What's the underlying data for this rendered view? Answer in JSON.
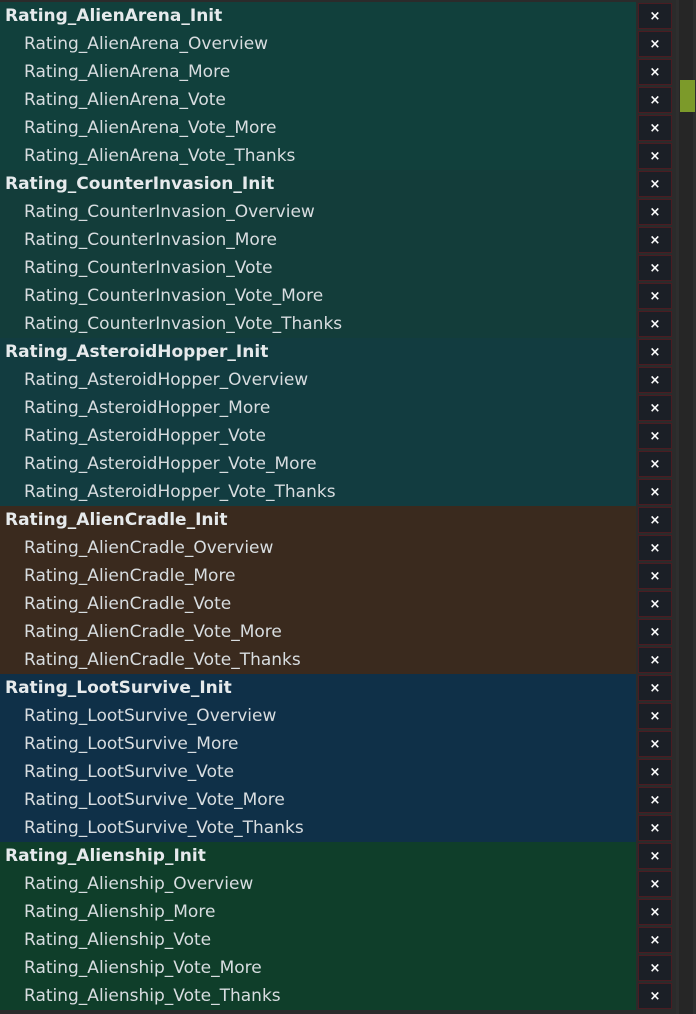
{
  "delete_glyph": "×",
  "groups": [
    {
      "color": "#11403c",
      "sep": "#22403f",
      "head": "Rating_AlienArena_Init",
      "items": [
        "Rating_AlienArena_Overview",
        "Rating_AlienArena_More",
        "Rating_AlienArena_Vote",
        "Rating_AlienArena_Vote_More",
        "Rating_AlienArena_Vote_Thanks"
      ]
    },
    {
      "color": "#133d3a",
      "sep": "#22403f",
      "head": "Rating_CounterInvasion_Init",
      "items": [
        "Rating_CounterInvasion_Overview",
        "Rating_CounterInvasion_More",
        "Rating_CounterInvasion_Vote",
        "Rating_CounterInvasion_Vote_More",
        "Rating_CounterInvasion_Vote_Thanks"
      ]
    },
    {
      "color": "#123c40",
      "sep": "#22403f",
      "head": "Rating_AsteroidHopper_Init",
      "items": [
        "Rating_AsteroidHopper_Overview",
        "Rating_AsteroidHopper_More",
        "Rating_AsteroidHopper_Vote",
        "Rating_AsteroidHopper_Vote_More",
        "Rating_AsteroidHopper_Vote_Thanks"
      ]
    },
    {
      "color": "#3a2a1e",
      "sep": "#4a3526",
      "head": "Rating_AlienCradle_Init",
      "items": [
        "Rating_AlienCradle_Overview",
        "Rating_AlienCradle_More",
        "Rating_AlienCradle_Vote",
        "Rating_AlienCradle_Vote_More",
        "Rating_AlienCradle_Vote_Thanks"
      ]
    },
    {
      "color": "#0f3048",
      "sep": "#1d4058",
      "head": "Rating_LootSurvive_Init",
      "items": [
        "Rating_LootSurvive_Overview",
        "Rating_LootSurvive_More",
        "Rating_LootSurvive_Vote",
        "Rating_LootSurvive_Vote_More",
        "Rating_LootSurvive_Vote_Thanks"
      ]
    },
    {
      "color": "#0f3e2a",
      "sep": "#1d4c36",
      "head": "Rating_Alienship_Init",
      "items": [
        "Rating_Alienship_Overview",
        "Rating_Alienship_More",
        "Rating_Alienship_Vote",
        "Rating_Alienship_Vote_More",
        "Rating_Alienship_Vote_Thanks"
      ]
    }
  ]
}
